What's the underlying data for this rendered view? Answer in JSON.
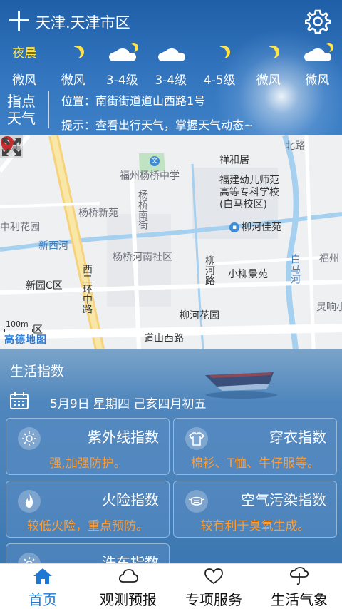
{
  "header": {
    "city": "天津.天津市区"
  },
  "forecast": [
    {
      "top": "夜晨",
      "icon": "",
      "wind": "微风"
    },
    {
      "top": "",
      "icon": "moon-icon",
      "wind": "微风"
    },
    {
      "top": "",
      "icon": "cloud-moon-icon",
      "wind": "3-4级"
    },
    {
      "top": "",
      "icon": "cloud-icon",
      "wind": "3-4级"
    },
    {
      "top": "",
      "icon": "moon-icon",
      "wind": "4-5级"
    },
    {
      "top": "",
      "icon": "moon-icon",
      "wind": "微风"
    },
    {
      "top": "",
      "icon": "cloud-moon-icon",
      "wind": "微风"
    }
  ],
  "info": {
    "badge": "指点天气",
    "location": "位置：南街街道道山西路1号",
    "tip": "提示：查看出行天气，掌握天气动态~"
  },
  "map": {
    "labels": {
      "school1": "福州杨桥中学",
      "xiangheju": "祥和居",
      "school2a": "福建幼儿师范",
      "school2b": "高等专科学校",
      "school2c": "(白马校区)",
      "yangqiaonanjie": "杨桥南街",
      "yangqiaoxinyuan": "杨桥新苑",
      "lihuayuan": "中利花园",
      "liuhejiayuan": "柳河佳苑",
      "xinxihe": "新西河",
      "yangqiaohenan": "杨桥河南社区",
      "liuhelu": "柳河路",
      "xiaoliujingyuan": "小柳景苑",
      "baimahe": "白马河",
      "fuzhou": "福州",
      "xinyuanc": "新园C区",
      "xierhuan": "西二环中路",
      "liuhehuayuan": "柳河花园",
      "lingxiang": "灵响小",
      "daoshanxilu": "道山西路",
      "xiqu": "区",
      "tianli": "天里",
      "beilu": "北路",
      "scale": "100m",
      "brand": "高德地图"
    }
  },
  "life": {
    "title": "生活指数",
    "date": "5月9日  星期四  己亥四月初五",
    "cards": [
      {
        "title": "紫外线指数",
        "desc": "强,加强防护。",
        "icon": "sun-icon"
      },
      {
        "title": "穿衣指数",
        "desc": "棉衫、T恤、牛仔服等。",
        "icon": "shirt-icon"
      },
      {
        "title": "火险指数",
        "desc": "较低火险，重点预防。",
        "icon": "flame-icon"
      },
      {
        "title": "空气污染指数",
        "desc": "较有利于臭氧生成。",
        "icon": "mask-icon"
      },
      {
        "title": "洗车指数",
        "desc": "",
        "icon": "sun-icon"
      }
    ]
  },
  "tabs": [
    {
      "label": "首页",
      "icon": "home-icon",
      "active": true
    },
    {
      "label": "观测预报",
      "icon": "cloud-icon"
    },
    {
      "label": "专项服务",
      "icon": "heart-icon"
    },
    {
      "label": "生活气象",
      "icon": "umbrella-icon"
    }
  ],
  "colors": {
    "accent": "#1d77d6",
    "index_desc": "#ff9b2f",
    "night_label": "#ffe34d"
  }
}
